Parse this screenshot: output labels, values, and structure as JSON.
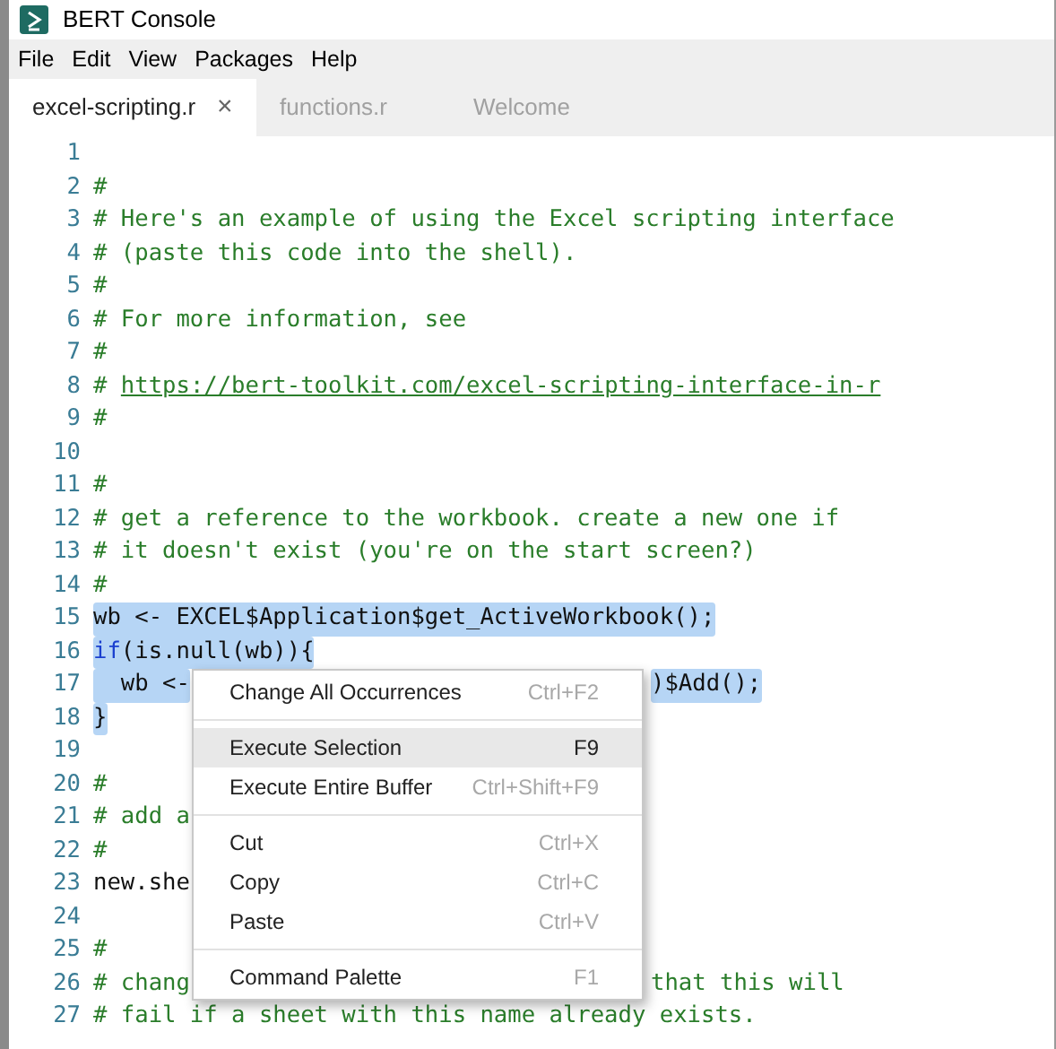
{
  "window": {
    "title": "BERT Console"
  },
  "menu_bar": [
    "File",
    "Edit",
    "View",
    "Packages",
    "Help"
  ],
  "tabs": [
    {
      "label": "excel-scripting.r",
      "selected": true,
      "close": "×"
    },
    {
      "label": "functions.r",
      "selected": false
    },
    {
      "label": "Welcome",
      "selected": false
    }
  ],
  "editor": {
    "lines": [
      {
        "number": "1",
        "selected": false
      },
      {
        "number": "2",
        "selected": false,
        "segments": [
          {
            "kind": "comment",
            "text": "#"
          }
        ]
      },
      {
        "number": "3",
        "selected": false,
        "segments": [
          {
            "kind": "comment",
            "text": "# Here's an example of using the Excel scripting interface"
          }
        ]
      },
      {
        "number": "4",
        "selected": false,
        "segments": [
          {
            "kind": "comment",
            "text": "# (paste this code into the shell)."
          }
        ]
      },
      {
        "number": "5",
        "selected": false,
        "segments": [
          {
            "kind": "comment",
            "text": "#"
          }
        ]
      },
      {
        "number": "6",
        "selected": false,
        "segments": [
          {
            "kind": "comment",
            "text": "# For more information, see"
          }
        ]
      },
      {
        "number": "7",
        "selected": false,
        "segments": [
          {
            "kind": "comment",
            "text": "#"
          }
        ]
      },
      {
        "number": "8",
        "selected": false,
        "segments": [
          {
            "kind": "comment",
            "text": "# "
          },
          {
            "kind": "link",
            "text": "https://bert-toolkit.com/excel-scripting-interface-in-r"
          }
        ]
      },
      {
        "number": "9",
        "selected": false,
        "segments": [
          {
            "kind": "comment",
            "text": "#"
          }
        ]
      },
      {
        "number": "10",
        "selected": false
      },
      {
        "number": "11",
        "selected": false,
        "segments": [
          {
            "kind": "comment",
            "text": "#"
          }
        ]
      },
      {
        "number": "12",
        "selected": false,
        "segments": [
          {
            "kind": "comment",
            "text": "# get a reference to the workbook. create a new one if"
          }
        ]
      },
      {
        "number": "13",
        "selected": false,
        "segments": [
          {
            "kind": "comment",
            "text": "# it doesn't exist (you're on the start screen?)"
          }
        ]
      },
      {
        "number": "14",
        "selected": false,
        "segments": [
          {
            "kind": "comment",
            "text": "#"
          }
        ]
      },
      {
        "number": "15",
        "selected": true,
        "segments": [
          {
            "kind": "plain",
            "text": "wb <- EXCEL$Application$get_ActiveWorkbook();"
          }
        ]
      },
      {
        "number": "16",
        "selected": true,
        "segments": [
          {
            "kind": "keyword",
            "text": "if"
          },
          {
            "kind": "plain",
            "text": "(is.null(wb)){"
          }
        ]
      },
      {
        "number": "17",
        "selected": true,
        "segments": [
          {
            "kind": "plain",
            "text": "  wb <-"
          }
        ],
        "tail": {
          "kind": "plain",
          "text": ")$Add();"
        }
      },
      {
        "number": "18",
        "selected": true,
        "segments": [
          {
            "kind": "plain",
            "text": "}"
          }
        ]
      },
      {
        "number": "19",
        "selected": false
      },
      {
        "number": "20",
        "selected": false,
        "segments": [
          {
            "kind": "comment",
            "text": "#"
          }
        ]
      },
      {
        "number": "21",
        "selected": false,
        "segments": [
          {
            "kind": "comment",
            "text": "# add a"
          }
        ]
      },
      {
        "number": "22",
        "selected": false,
        "segments": [
          {
            "kind": "comment",
            "text": "#"
          }
        ]
      },
      {
        "number": "23",
        "selected": false,
        "segments": [
          {
            "kind": "plain",
            "text": "new.she"
          }
        ]
      },
      {
        "number": "24",
        "selected": false
      },
      {
        "number": "25",
        "selected": false,
        "segments": [
          {
            "kind": "comment",
            "text": "#"
          }
        ]
      },
      {
        "number": "26",
        "selected": false,
        "segments": [
          {
            "kind": "comment",
            "text": "# chang"
          }
        ],
        "tail": {
          "kind": "comment",
          "text": "that this will"
        }
      },
      {
        "number": "27",
        "selected": false,
        "segments": [
          {
            "kind": "comment",
            "text": "# fail if a sheet with this name already exists."
          }
        ]
      }
    ]
  },
  "context_menu": [
    {
      "kind": "item",
      "label": "Change All Occurrences",
      "shortcut": "Ctrl+F2",
      "selected": false
    },
    {
      "kind": "separator"
    },
    {
      "kind": "item",
      "label": "Execute Selection",
      "shortcut": "F9",
      "selected": true
    },
    {
      "kind": "item",
      "label": "Execute Entire Buffer",
      "shortcut": "Ctrl+Shift+F9",
      "selected": false
    },
    {
      "kind": "separator"
    },
    {
      "kind": "item",
      "label": "Cut",
      "shortcut": "Ctrl+X",
      "selected": false
    },
    {
      "kind": "item",
      "label": "Copy",
      "shortcut": "Ctrl+C",
      "selected": false
    },
    {
      "kind": "item",
      "label": "Paste",
      "shortcut": "Ctrl+V",
      "selected": false
    },
    {
      "kind": "separator"
    },
    {
      "kind": "item",
      "label": "Command Palette",
      "shortcut": "F1",
      "selected": false
    }
  ]
}
